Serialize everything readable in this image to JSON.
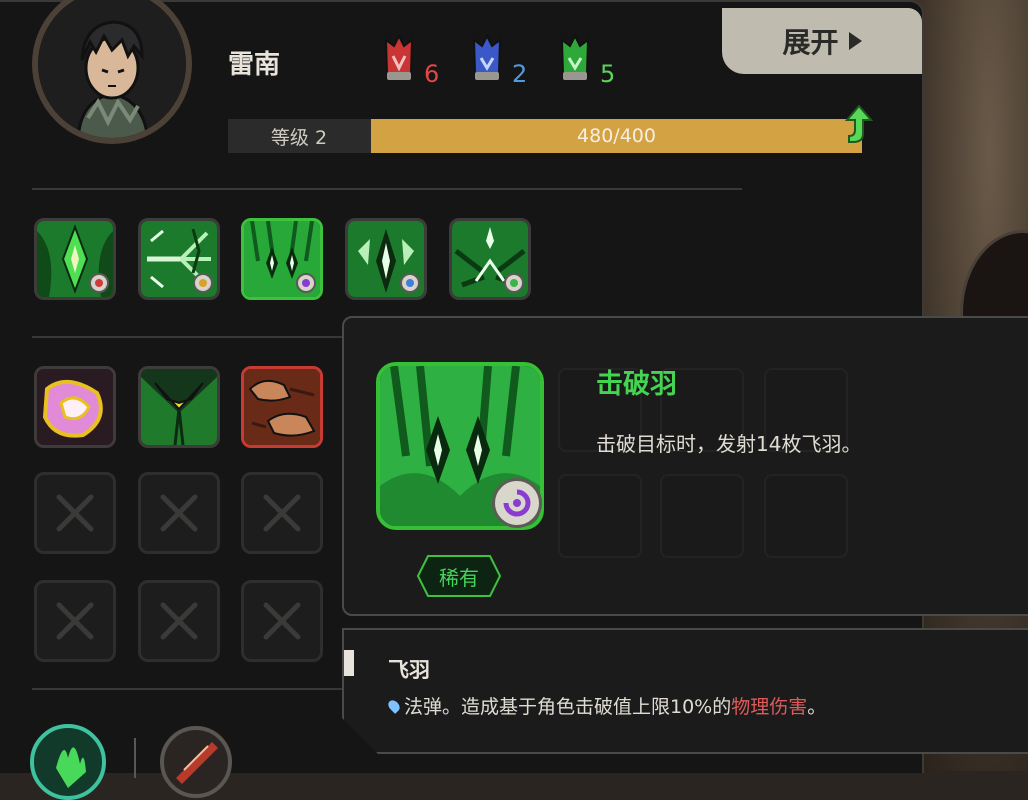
{
  "header": {
    "expand_label": "展开",
    "character_name": "雷南",
    "gems": [
      {
        "name": "red-gem-icon",
        "count": "6",
        "color": "#e04848"
      },
      {
        "name": "blue-gem-icon",
        "count": "2",
        "color": "#4f9be0"
      },
      {
        "name": "green-gem-icon",
        "count": "5",
        "color": "#5ad45a"
      }
    ]
  },
  "level": {
    "label": "等级 2",
    "xp_text": "480/400",
    "fill_fraction": 1.0,
    "bar_color": "#d3a243"
  },
  "skills": [
    {
      "name": "skill-slot-1",
      "badge": "red"
    },
    {
      "name": "skill-slot-2",
      "badge": "yellow"
    },
    {
      "name": "skill-slot-3",
      "badge": "purple",
      "selected": true
    },
    {
      "name": "skill-slot-4",
      "badge": "blue"
    },
    {
      "name": "skill-slot-5",
      "badge": "green"
    }
  ],
  "tooltip": {
    "title": "击破羽",
    "description": "击破目标时，发射14枚飞羽。",
    "rarity": "稀有",
    "title_color": "#44d451"
  },
  "info": {
    "title": "飞羽",
    "desc_prefix": "法弹。造成基于角色击破值上限10%的",
    "desc_highlight": "物理伤害",
    "desc_suffix": "。",
    "highlight_color": "#e05a5a"
  }
}
